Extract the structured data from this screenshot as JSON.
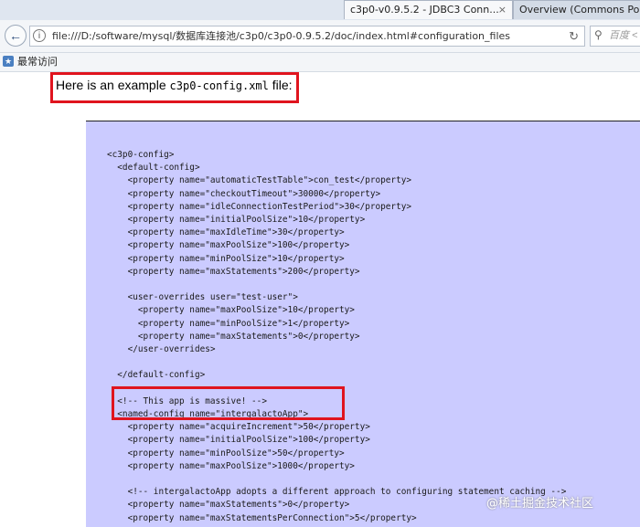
{
  "browser": {
    "tabs": [
      {
        "title": "c3p0-v0.9.5.2 - JDBC3 Conn...",
        "active": true
      },
      {
        "title": "Overview (Commons Pool",
        "active": false
      }
    ],
    "close_glyph": "×",
    "url": "file:///D:/software/mysql/数据库连接池/c3p0/c3p0-0.9.5.2/doc/index.html#configuration_files",
    "search_placeholder": "百度 <",
    "bookmarks": [
      {
        "label": "最常访问"
      }
    ]
  },
  "content": {
    "intro_prefix": "Here is an example ",
    "intro_code": "c3p0-config.xml",
    "intro_suffix": " file:",
    "code_lines": [
      "<c3p0-config>",
      "  <default-config>",
      "    <property name=\"automaticTestTable\">con_test</property>",
      "    <property name=\"checkoutTimeout\">30000</property>",
      "    <property name=\"idleConnectionTestPeriod\">30</property>",
      "    <property name=\"initialPoolSize\">10</property>",
      "    <property name=\"maxIdleTime\">30</property>",
      "    <property name=\"maxPoolSize\">100</property>",
      "    <property name=\"minPoolSize\">10</property>",
      "    <property name=\"maxStatements\">200</property>",
      "",
      "    <user-overrides user=\"test-user\">",
      "      <property name=\"maxPoolSize\">10</property>",
      "      <property name=\"minPoolSize\">1</property>",
      "      <property name=\"maxStatements\">0</property>",
      "    </user-overrides>",
      "",
      "  </default-config>",
      "",
      "  <!-- This app is massive! -->",
      "  <named-config name=\"intergalactoApp\">",
      "    <property name=\"acquireIncrement\">50</property>",
      "    <property name=\"initialPoolSize\">100</property>",
      "    <property name=\"minPoolSize\">50</property>",
      "    <property name=\"maxPoolSize\">1000</property>",
      "",
      "    <!-- intergalactoApp adopts a different approach to configuring statement caching -->",
      "    <property name=\"maxStatements\">0</property>",
      "    <property name=\"maxStatementsPerConnection\">5</property>"
    ]
  },
  "watermark": "@稀土掘金技术社区",
  "colors": {
    "code_background": "#cbcbff",
    "highlight_border": "#e0141e"
  }
}
